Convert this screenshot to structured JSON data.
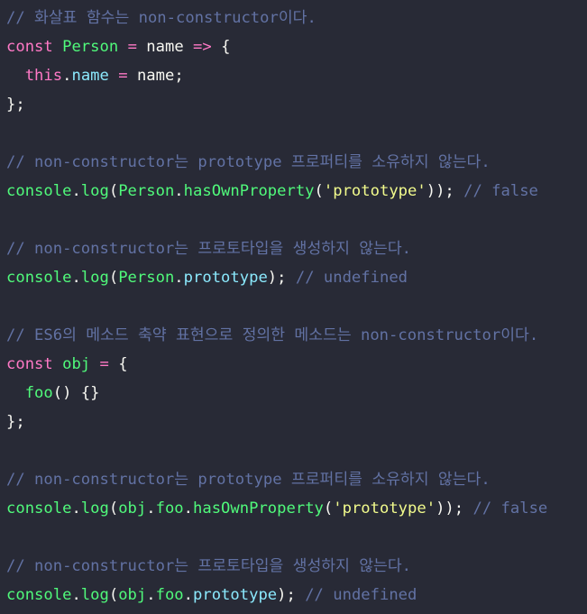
{
  "code": {
    "lines": [
      [
        {
          "t": "comment",
          "v": "// 화살표 함수는 non-constructor이다."
        }
      ],
      [
        {
          "t": "keyword",
          "v": "const"
        },
        {
          "t": "plain",
          "v": " "
        },
        {
          "t": "func",
          "v": "Person"
        },
        {
          "t": "plain",
          "v": " "
        },
        {
          "t": "keyword",
          "v": "="
        },
        {
          "t": "plain",
          "v": " "
        },
        {
          "t": "plain",
          "v": "name"
        },
        {
          "t": "plain",
          "v": " "
        },
        {
          "t": "keyword",
          "v": "=>"
        },
        {
          "t": "plain",
          "v": " {"
        }
      ],
      [
        {
          "t": "plain",
          "v": "  "
        },
        {
          "t": "this",
          "v": "this"
        },
        {
          "t": "plain",
          "v": "."
        },
        {
          "t": "prop",
          "v": "name"
        },
        {
          "t": "plain",
          "v": " "
        },
        {
          "t": "keyword",
          "v": "="
        },
        {
          "t": "plain",
          "v": " name;"
        }
      ],
      [
        {
          "t": "plain",
          "v": "};"
        }
      ],
      [
        {
          "t": "plain",
          "v": ""
        }
      ],
      [
        {
          "t": "comment",
          "v": "// non-constructor는 prototype 프로퍼티를 소유하지 않는다."
        }
      ],
      [
        {
          "t": "func",
          "v": "console"
        },
        {
          "t": "plain",
          "v": "."
        },
        {
          "t": "func",
          "v": "log"
        },
        {
          "t": "plain",
          "v": "("
        },
        {
          "t": "func",
          "v": "Person"
        },
        {
          "t": "plain",
          "v": "."
        },
        {
          "t": "func",
          "v": "hasOwnProperty"
        },
        {
          "t": "plain",
          "v": "("
        },
        {
          "t": "string",
          "v": "'prototype'"
        },
        {
          "t": "plain",
          "v": ")); "
        },
        {
          "t": "comment",
          "v": "// false"
        }
      ],
      [
        {
          "t": "plain",
          "v": ""
        }
      ],
      [
        {
          "t": "comment",
          "v": "// non-constructor는 프로토타입을 생성하지 않는다."
        }
      ],
      [
        {
          "t": "func",
          "v": "console"
        },
        {
          "t": "plain",
          "v": "."
        },
        {
          "t": "func",
          "v": "log"
        },
        {
          "t": "plain",
          "v": "("
        },
        {
          "t": "func",
          "v": "Person"
        },
        {
          "t": "plain",
          "v": "."
        },
        {
          "t": "prop",
          "v": "prototype"
        },
        {
          "t": "plain",
          "v": "); "
        },
        {
          "t": "comment",
          "v": "// undefined"
        }
      ],
      [
        {
          "t": "plain",
          "v": ""
        }
      ],
      [
        {
          "t": "comment",
          "v": "// ES6의 메소드 축약 표현으로 정의한 메소드는 non-constructor이다."
        }
      ],
      [
        {
          "t": "keyword",
          "v": "const"
        },
        {
          "t": "plain",
          "v": " "
        },
        {
          "t": "func",
          "v": "obj"
        },
        {
          "t": "plain",
          "v": " "
        },
        {
          "t": "keyword",
          "v": "="
        },
        {
          "t": "plain",
          "v": " {"
        }
      ],
      [
        {
          "t": "plain",
          "v": "  "
        },
        {
          "t": "func",
          "v": "foo"
        },
        {
          "t": "plain",
          "v": "() {}"
        }
      ],
      [
        {
          "t": "plain",
          "v": "};"
        }
      ],
      [
        {
          "t": "plain",
          "v": ""
        }
      ],
      [
        {
          "t": "comment",
          "v": "// non-constructor는 prototype 프로퍼티를 소유하지 않는다."
        }
      ],
      [
        {
          "t": "func",
          "v": "console"
        },
        {
          "t": "plain",
          "v": "."
        },
        {
          "t": "func",
          "v": "log"
        },
        {
          "t": "plain",
          "v": "("
        },
        {
          "t": "func",
          "v": "obj"
        },
        {
          "t": "plain",
          "v": "."
        },
        {
          "t": "func",
          "v": "foo"
        },
        {
          "t": "plain",
          "v": "."
        },
        {
          "t": "func",
          "v": "hasOwnProperty"
        },
        {
          "t": "plain",
          "v": "("
        },
        {
          "t": "string",
          "v": "'prototype'"
        },
        {
          "t": "plain",
          "v": ")); "
        },
        {
          "t": "comment",
          "v": "// false"
        }
      ],
      [
        {
          "t": "plain",
          "v": ""
        }
      ],
      [
        {
          "t": "comment",
          "v": "// non-constructor는 프로토타입을 생성하지 않는다."
        }
      ],
      [
        {
          "t": "func",
          "v": "console"
        },
        {
          "t": "plain",
          "v": "."
        },
        {
          "t": "func",
          "v": "log"
        },
        {
          "t": "plain",
          "v": "("
        },
        {
          "t": "func",
          "v": "obj"
        },
        {
          "t": "plain",
          "v": "."
        },
        {
          "t": "func",
          "v": "foo"
        },
        {
          "t": "plain",
          "v": "."
        },
        {
          "t": "prop",
          "v": "prototype"
        },
        {
          "t": "plain",
          "v": "); "
        },
        {
          "t": "comment",
          "v": "// undefined"
        }
      ]
    ]
  },
  "colors": {
    "background": "#282a36",
    "comment": "#6272a4",
    "keyword": "#ff79c6",
    "function": "#50fa7b",
    "property": "#8be9fd",
    "string": "#f1fa8c",
    "plain": "#f8f8f2"
  }
}
